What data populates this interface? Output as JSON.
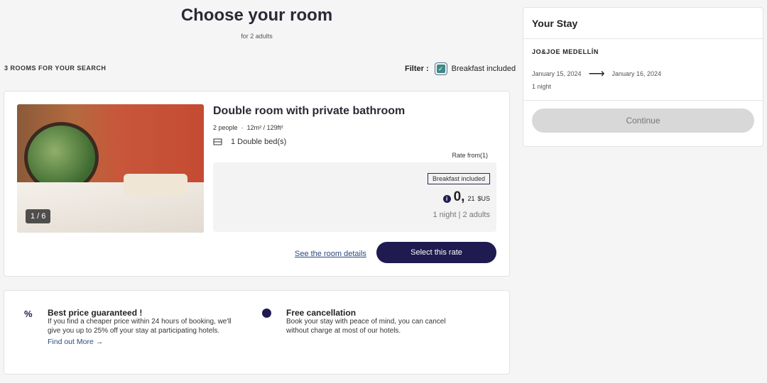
{
  "header": {
    "title": "Choose your room",
    "subtitle": "for 2 adults"
  },
  "results": {
    "count_label": "3 ROOMS FOR YOUR SEARCH",
    "filter_label": "Filter :",
    "filter_option": "Breakfast included",
    "filter_checked": true
  },
  "room": {
    "title": "Double room with private bathroom",
    "capacity": "2 people",
    "separator": "·",
    "size": "12m² / 129ft²",
    "beds": "1 Double bed(s)",
    "photo_counter": "1 / 6",
    "rate_from": "Rate from(1)",
    "rate": {
      "badge": "Breakfast included",
      "price_int": "0,",
      "price_dec": "21",
      "currency": "$US",
      "details": "1 night | 2 adults"
    },
    "details_link": "See the room details",
    "select_button": "Select this rate"
  },
  "promos": [
    {
      "icon": "percent-icon",
      "title": "Best price guaranteed !",
      "text": "If you find a cheaper price within 24 hours of booking, we'll give you up to 25% off your stay at participating hotels.",
      "link": "Find out More"
    },
    {
      "icon": "clock-icon",
      "title": "Free cancellation",
      "text": "Book your stay with peace of mind, you can cancel without charge at most of our hotels."
    }
  ],
  "stay": {
    "title": "Your Stay",
    "hotel": "JO&JOE MEDELLÍN",
    "checkin": "January 15, 2024",
    "checkout": "January 16, 2024",
    "nights": "1 night",
    "continue": "Continue"
  },
  "colors": {
    "primary": "#1f1a4f",
    "checkbox": "#3d8a86",
    "link": "#2a4a80"
  }
}
